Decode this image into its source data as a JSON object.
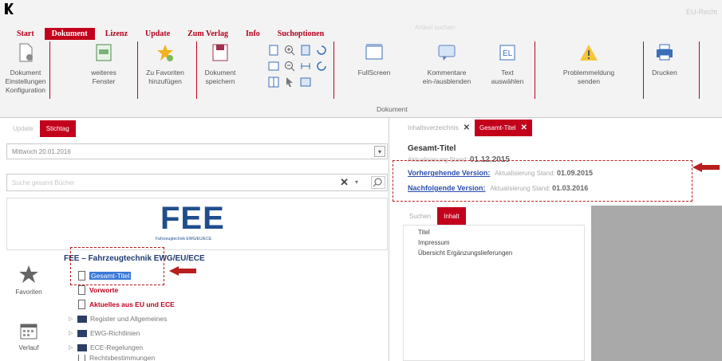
{
  "app": {
    "title_right": "EU-Recht"
  },
  "menu": {
    "items": [
      "Start",
      "Dokument",
      "Lizenz",
      "Update",
      "Zum Verlag",
      "Info",
      "Suchoptionen"
    ],
    "active": "Dokument",
    "ghost": "Artikel suchen"
  },
  "ribbon": {
    "buttons": {
      "dokument_einstellungen": "Dokument\nEinstellungen\nKonfiguration",
      "weiteres_fenster": "weiteres\nFenster",
      "zu_favoriten": "Zu Favoriten\nhinzufügen",
      "dokument_speichern": "Dokument\nspeichern",
      "fullscreen": "FullScreen",
      "kommentare": "Kommentare\nein-/ausblenden",
      "text_auswaehlen": "Text\nauswählen",
      "problemmeldung": "Problemmeldung\nsenden",
      "drucken": "Drucken"
    },
    "group_label": "Dokument"
  },
  "left": {
    "tabs": [
      "Update",
      "Stichtag"
    ],
    "active_tab": "Stichtag",
    "date_value": "Mittwoch 20.01.2016",
    "search_placeholder": "Suche gesamt Bücher",
    "banner_logo": "FEE",
    "banner_subtitle": "Fahrzeugtechnik EWG/EU/ECE",
    "sidebar": {
      "favoriten": "Favoriten",
      "verlauf": "Verlauf"
    },
    "tree": {
      "root": "FEE – Fahrzeugtechnik EWG/EU/ECE",
      "items": [
        {
          "label": "Gesamt-Titel",
          "kind": "doc",
          "style": "selected"
        },
        {
          "label": "Vorworte",
          "kind": "doc",
          "style": "red"
        },
        {
          "label": "Aktuelles aus EU und ECE",
          "kind": "doc",
          "style": "red"
        },
        {
          "label": "Register und Allgemeines",
          "kind": "folder",
          "style": "normal"
        },
        {
          "label": "EWG-Richtlinien",
          "kind": "folder",
          "style": "normal"
        },
        {
          "label": "ECE-Regelungen",
          "kind": "folder",
          "style": "normal"
        },
        {
          "label": "Rechtsbestimmungen",
          "kind": "doc",
          "style": "normal"
        }
      ]
    }
  },
  "right": {
    "tabs": [
      {
        "label": "Inhaltsverzeichnis",
        "active": false
      },
      {
        "label": "Gesamt-Titel",
        "active": true
      }
    ],
    "doc_title": "Gesamt-Titel",
    "stand_prefix": "Aktualisierung Stand:",
    "stand_date": "01.12.2015",
    "prev_version": {
      "link": "Vorhergehende Version:",
      "prefix": "Aktualisierung Stand:",
      "date": "01.09.2015"
    },
    "next_version": {
      "link": "Nachfolgende Version:",
      "prefix": "Aktualisierung Stand:",
      "date": "01.03.2016"
    },
    "subtabs": [
      "Suchen",
      "Inhalt"
    ],
    "active_subtab": "Inhalt",
    "toc": [
      "Titel",
      "Impressum",
      "Übersicht Ergänzungslieferungen"
    ]
  },
  "colors": {
    "accent": "#c2001b",
    "link": "#2a4fb0",
    "annotation": "#b81e1e",
    "logo_blue": "#1f4e8c"
  }
}
